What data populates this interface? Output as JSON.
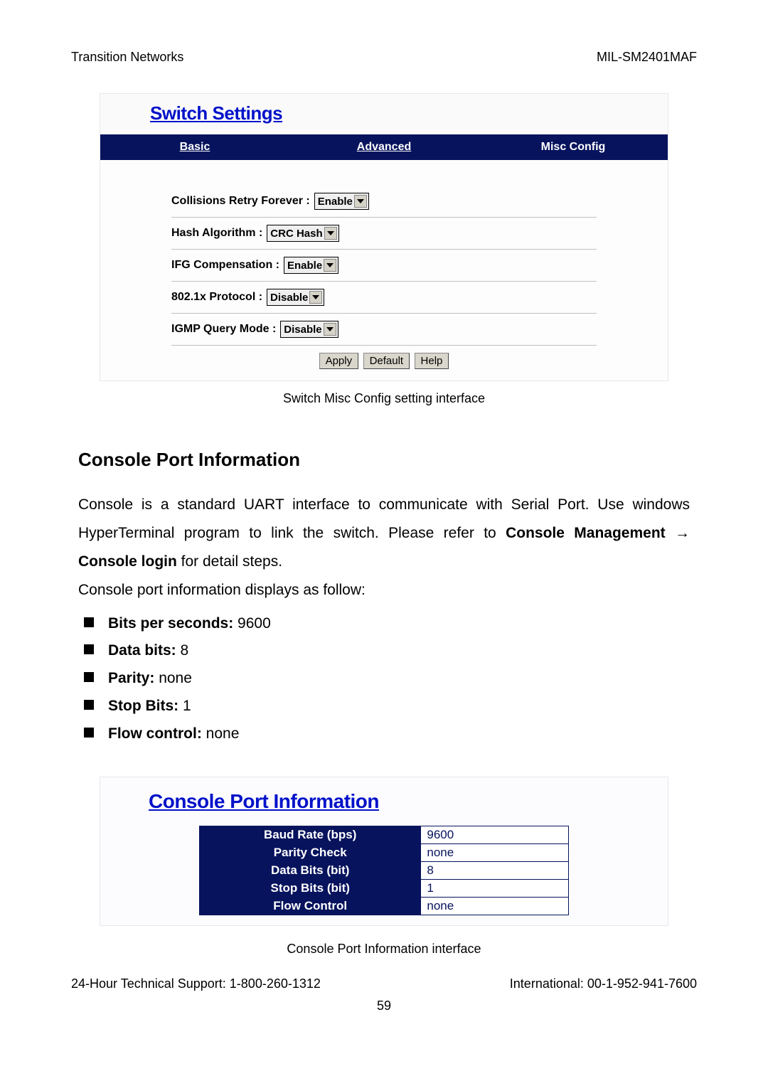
{
  "header": {
    "left": "Transition Networks",
    "right": "MIL-SM2401MAF"
  },
  "switch": {
    "title": "Switch Settings",
    "tabs": {
      "basic": "Basic",
      "adv": "Advanced",
      "misc": "Misc Config"
    },
    "rows": {
      "collisions_label": "Collisions Retry Forever :",
      "collisions_val": "Enable",
      "hash_label": "Hash Algorithm :",
      "hash_val": "CRC Hash",
      "ifg_label": "IFG Compensation :",
      "ifg_val": "Enable",
      "p802_label": "802.1x Protocol :",
      "p802_val": "Disable",
      "igmp_label": "IGMP Query Mode :",
      "igmp_val": "Disable"
    },
    "btn": {
      "apply": "Apply",
      "default": "Default",
      "help": "Help"
    },
    "caption": "Switch Misc Config setting interface"
  },
  "console": {
    "heading": "Console Port Information",
    "p1a": "Console is a standard UART interface to communicate with Serial Port. Use windows HyperTerminal program to link the switch. Please refer to ",
    "p1b": "Console Management ",
    "p1c": "Console login",
    "p1d": " for detail steps.",
    "p2": "Console port information displays as follow:",
    "li": {
      "l1a": "Bits per seconds:",
      "l1b": " 9600",
      "l2a": "Data bits:",
      "l2b": " 8",
      "l3a": "Parity:",
      "l3b": " none",
      "l4a": "Stop Bits:",
      "l4b": " 1",
      "l5a": "Flow control:",
      "l5b": " none"
    },
    "panel_title": "Console Port Information",
    "tbl": {
      "r1k": "Baud Rate (bps)",
      "r1v": "9600",
      "r2k": "Parity Check",
      "r2v": "none",
      "r3k": "Data Bits (bit)",
      "r3v": "8",
      "r4k": "Stop Bits (bit)",
      "r4v": "1",
      "r5k": "Flow Control",
      "r5v": "none"
    },
    "caption": "Console Port Information interface"
  },
  "footer": {
    "left": "24-Hour Technical Support: 1-800-260-1312",
    "right": "International: 00-1-952-941-7600",
    "page": "59"
  }
}
